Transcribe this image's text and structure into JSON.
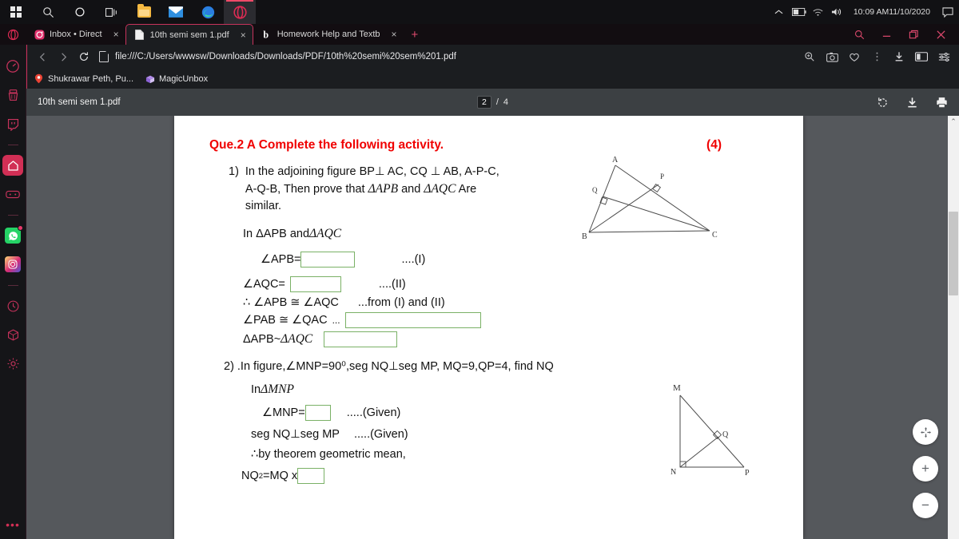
{
  "taskbar": {
    "icons": [
      {
        "name": "windows-start-icon",
        "label": "Start"
      },
      {
        "name": "search-icon",
        "label": "Search"
      },
      {
        "name": "cortana-icon",
        "label": "Cortana"
      },
      {
        "name": "task-view-icon",
        "label": "Task View"
      },
      {
        "name": "file-explorer-icon",
        "label": "File Explorer"
      },
      {
        "name": "mail-icon",
        "label": "Mail"
      },
      {
        "name": "edge-icon",
        "label": "Microsoft Edge"
      },
      {
        "name": "opera-icon",
        "label": "Opera"
      }
    ],
    "tray": {
      "chevron": "⌃",
      "battery": "battery-icon",
      "wifi": "wifi-icon",
      "volume": "volume-icon",
      "time": "10:09 AM",
      "date": "11/10/2020",
      "notifications": "notification-icon"
    }
  },
  "browser": {
    "tabs": [
      {
        "title": "Inbox • Direct",
        "favicon": "instagram-icon",
        "active": false,
        "close": "×"
      },
      {
        "title": "10th semi sem 1.pdf",
        "favicon": "pdf-file-icon",
        "active": true,
        "close": "×"
      },
      {
        "title": "Homework Help and Textb",
        "favicon": "bartleby-icon",
        "active": false,
        "close": "×"
      }
    ],
    "new_tab_label": "+",
    "window_controls": {
      "search": "⚲",
      "minimize": "—",
      "maximize": "❐",
      "close": "✕"
    },
    "nav": {
      "back": "‹",
      "forward": "›",
      "reload": "⟳",
      "url": "file:///C:/Users/wwwsw/Downloads/Downloads/PDF/10th%20semi%20sem%201.pdf",
      "page_icon": "document-icon",
      "right_icons": [
        {
          "name": "zoom-page-icon",
          "glyph": "⌕"
        },
        {
          "name": "snapshot-icon",
          "glyph": "⎙"
        },
        {
          "name": "heart-icon",
          "glyph": "♡"
        },
        {
          "name": "menu-dots-icon",
          "glyph": "⋮"
        },
        {
          "name": "download-icon",
          "glyph": "⬇"
        },
        {
          "name": "sidebar-toggle-icon",
          "glyph": "▣"
        },
        {
          "name": "easy-setup-icon",
          "glyph": "≡"
        }
      ]
    },
    "bookmarks": [
      {
        "label": "Shukrawar Peth, Pu...",
        "icon": "map-pin-icon"
      },
      {
        "label": "MagicUnbox",
        "icon": "magicunbox-icon"
      }
    ],
    "sidebar": [
      {
        "name": "sidebar-item-speeddial",
        "glyph": "◔",
        "active": false,
        "badge": false
      },
      {
        "name": "sidebar-item-cleaner",
        "glyph": "⌨",
        "active": false,
        "badge": false
      },
      {
        "name": "sidebar-item-twitch",
        "glyph": "⬚",
        "active": false,
        "badge": false
      },
      {
        "name": "sidebar-item-home",
        "glyph": "⌂",
        "active": true,
        "badge": false
      },
      {
        "name": "sidebar-item-gaming",
        "glyph": "⬛",
        "active": false,
        "badge": false
      },
      {
        "name": "sidebar-item-whatsapp",
        "glyph": "✆",
        "active": false,
        "badge": true
      },
      {
        "name": "sidebar-item-instagram",
        "glyph": "◎",
        "active": false,
        "badge": false
      },
      {
        "name": "sidebar-item-history",
        "glyph": "◴",
        "active": false,
        "badge": false
      },
      {
        "name": "sidebar-item-box",
        "glyph": "⬡",
        "active": false,
        "badge": false
      },
      {
        "name": "sidebar-item-settings",
        "glyph": "⚙",
        "active": false,
        "badge": false
      }
    ],
    "sidebar_more": "•••"
  },
  "pdf_viewer": {
    "file_name": "10th semi sem 1.pdf",
    "current_page": "2",
    "page_separator": "/",
    "total_pages": "4",
    "tools": [
      {
        "name": "rotate-icon",
        "glyph": "↻"
      },
      {
        "name": "download-icon",
        "glyph": "⬇"
      },
      {
        "name": "print-icon",
        "glyph": "⎙"
      }
    ],
    "zoom_controls": [
      {
        "name": "fit-page-button",
        "glyph": "✥"
      },
      {
        "name": "zoom-in-button",
        "glyph": "+"
      },
      {
        "name": "zoom-out-button",
        "glyph": "−"
      }
    ],
    "scroll_up_arrow": "⌃",
    "scroll_down_arrow": "⌄"
  },
  "document": {
    "heading": "Que.2 A Complete the following activity.",
    "marks": "(4)",
    "q1": {
      "number": "1)",
      "line1": "In the adjoining figure BP⊥ AC, CQ ⊥ AB, A-P-C,",
      "line2_a": "A-Q-B, Then prove that ",
      "line2_math1": "ΔAPB",
      "line2_b": " and ",
      "line2_math2": "ΔAQC",
      "line2_c": " Are",
      "line3": "similar.",
      "in_line_a": "In ΔAPB and ",
      "in_line_math": "ΔAQC",
      "step1_label": "∠APB=",
      "step1_ref": "....(I)",
      "step2_label": "∠AQC=",
      "step2_ref": "....(II)",
      "step3": "∴ ∠APB ≅ ∠AQC",
      "step3_ref": "...from (I) and (II)",
      "step4": "∠PAB ≅ ∠QAC",
      "step4_dots": "...",
      "step5_a": "ΔAPB~",
      "step5_math": "ΔAQC"
    },
    "q2": {
      "number": "2)",
      "line1": ".In figure,∠MNP=90⁰,seg NQ⊥seg MP, MQ=9,QP=4, find NQ",
      "in_line_a": "In ",
      "in_line_math": "ΔMNP",
      "step1_label": "∠MNP=",
      "step1_ref": ".....(Given)",
      "step2": "seg NQ⊥seg MP",
      "step2_ref": ".....(Given)",
      "step3": "∴by theorem geometric mean,",
      "step4_a": "NQ",
      "step4_sup": "2",
      "step4_b": "=MQ x"
    },
    "figure1": {
      "name": "triangle-abc-altitudes-figure",
      "labels": [
        "A",
        "P",
        "Q",
        "B",
        "C"
      ]
    },
    "figure2": {
      "name": "triangle-mnp-altitude-figure",
      "labels": [
        "M",
        "Q",
        "N",
        "P"
      ]
    }
  },
  "colors": {
    "heading_red": "#f00000",
    "input_border_green": "#7ab166",
    "opera_accent": "#c8335c",
    "pdf_toolbar": "#3c4043"
  }
}
